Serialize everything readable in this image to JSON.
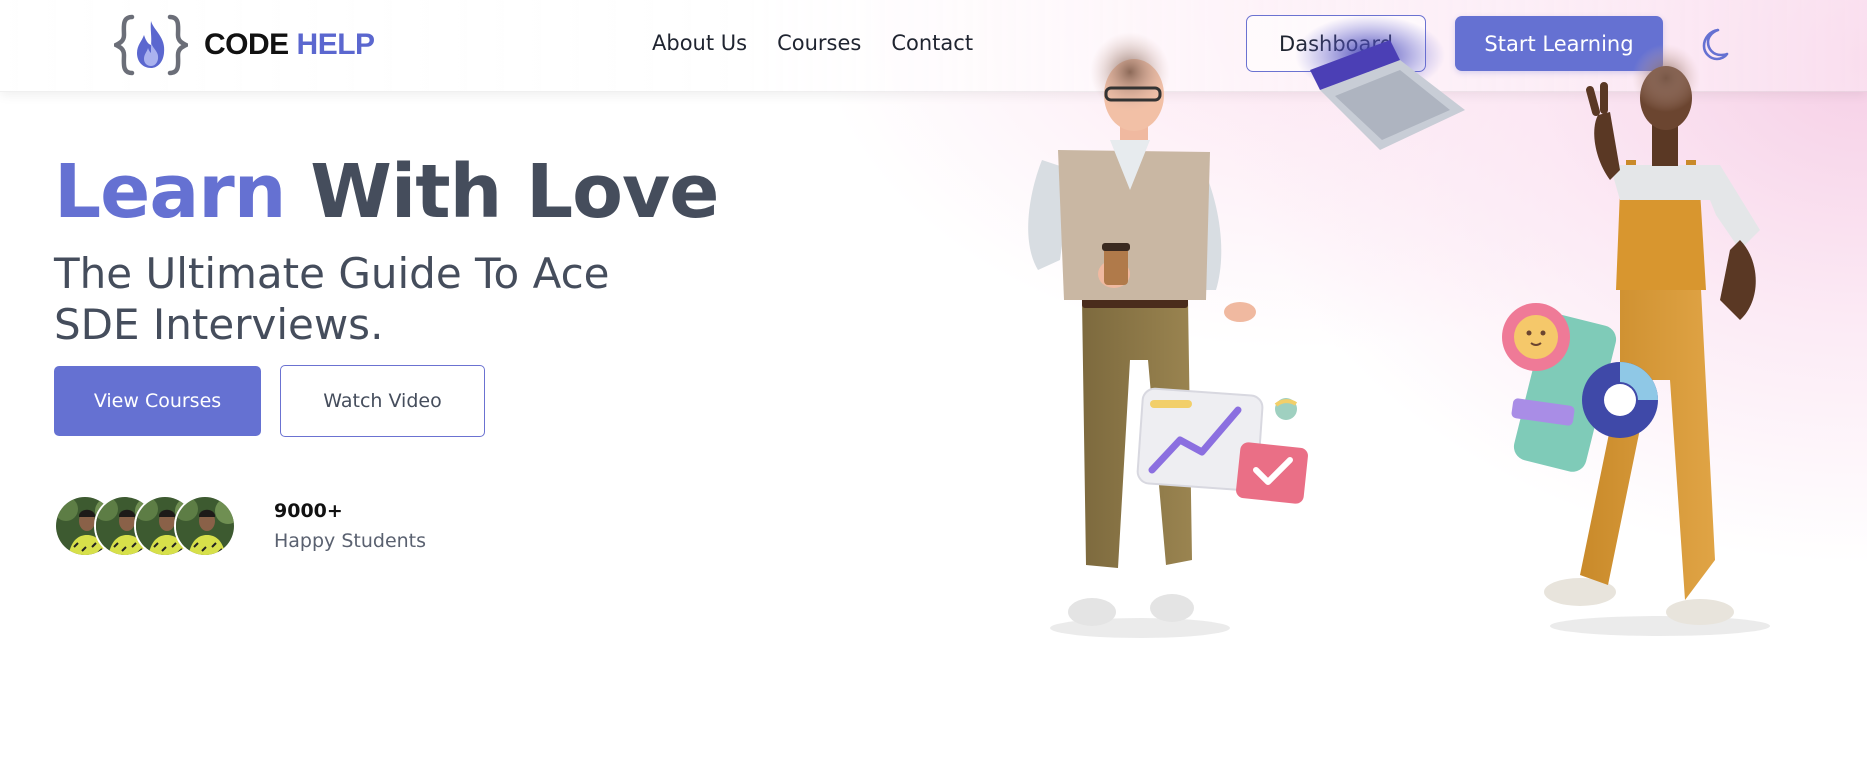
{
  "brand": {
    "code": "CODE",
    "help": "HELP",
    "accent_color": "#5b67cf"
  },
  "nav": {
    "links": [
      "About Us",
      "Courses",
      "Contact"
    ],
    "dashboard_label": "Dashboard",
    "start_label": "Start Learning",
    "theme_icon": "moon-icon"
  },
  "hero": {
    "title_accent": "Learn",
    "title_rest": "With Love",
    "subtitle_line1": "The Ultimate Guide To Ace",
    "subtitle_line2": "SDE Interviews.",
    "primary_button": "View Courses",
    "secondary_button": "Watch Video"
  },
  "stats": {
    "count": "9000+",
    "label": "Happy Students"
  },
  "colors": {
    "primary": "#6571d2",
    "heading": "#454d5c",
    "hero_bg_tint": "#f6cfe6"
  }
}
